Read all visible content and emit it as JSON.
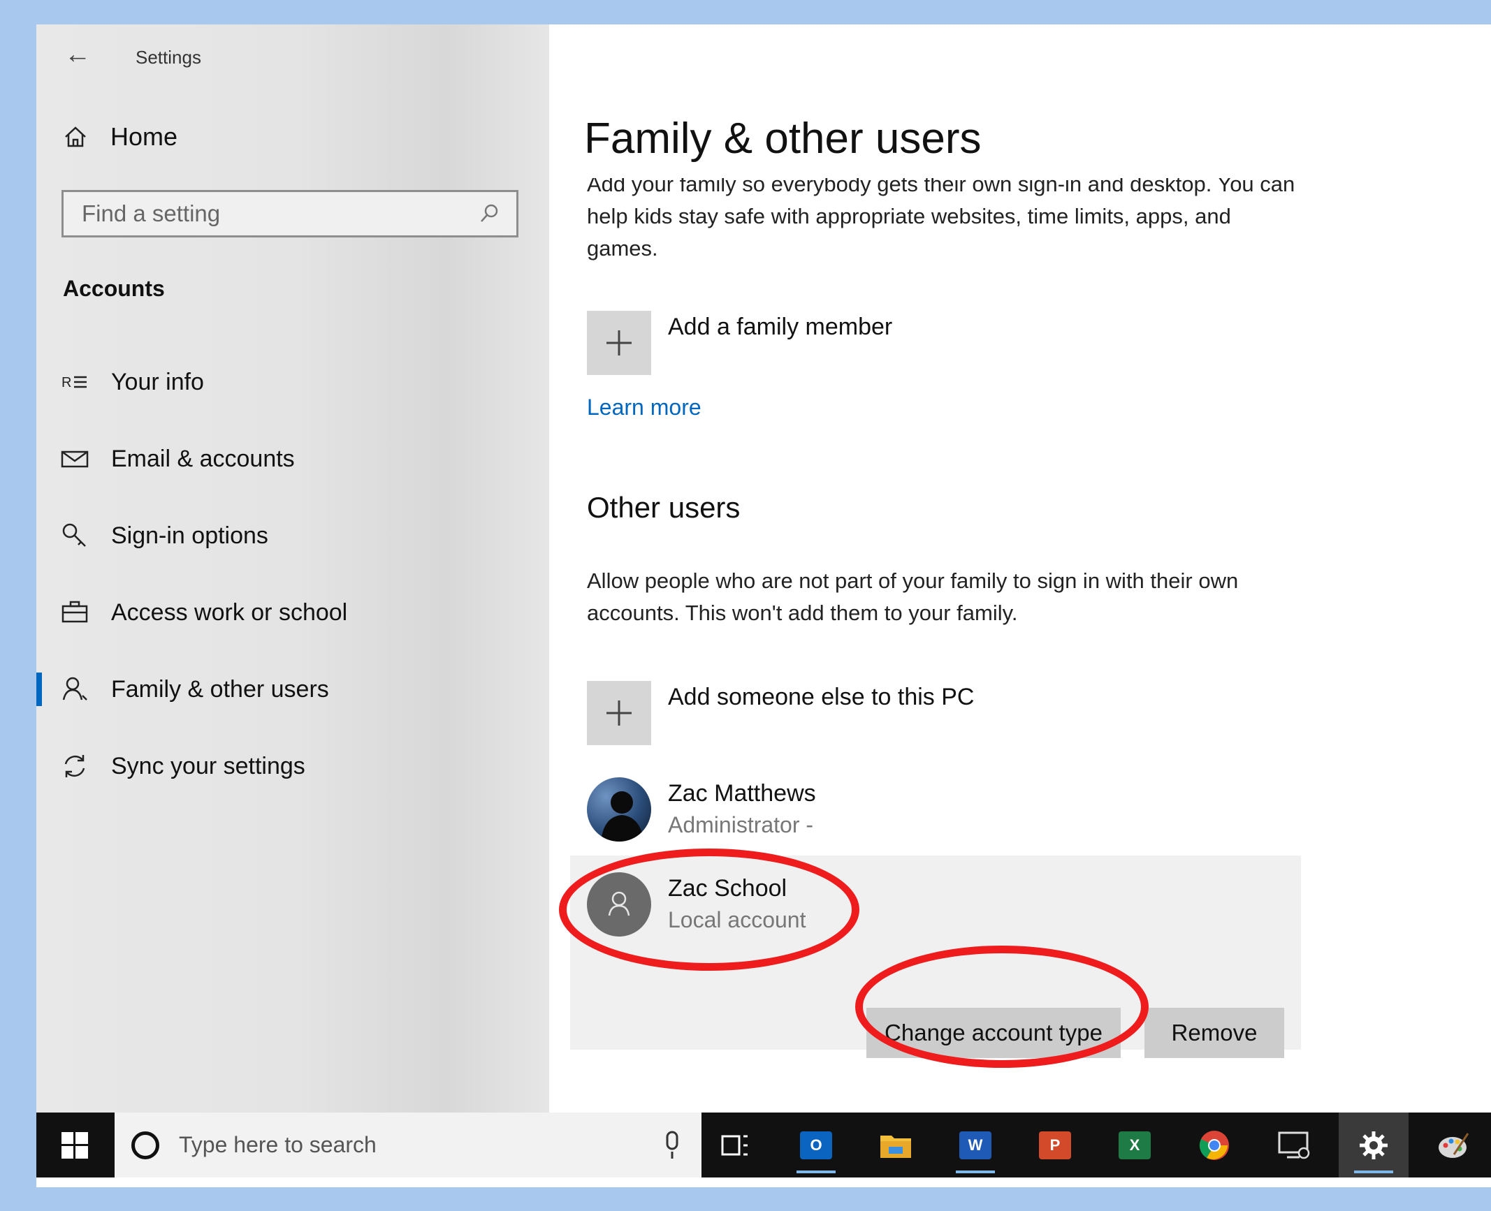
{
  "window": {
    "title": "Settings"
  },
  "sidebar": {
    "home_label": "Home",
    "search_placeholder": "Find a setting",
    "section_title": "Accounts",
    "items": [
      {
        "label": "Your info",
        "icon": "contact-card-icon"
      },
      {
        "label": "Email & accounts",
        "icon": "mail-icon"
      },
      {
        "label": "Sign-in options",
        "icon": "key-icon"
      },
      {
        "label": "Access work or school",
        "icon": "briefcase-icon"
      },
      {
        "label": "Family & other users",
        "icon": "person-icon",
        "active": true
      },
      {
        "label": "Sync your settings",
        "icon": "sync-icon"
      }
    ]
  },
  "main": {
    "title": "Family & other users",
    "family_description": "Add your family so everybody gets their own sign-in and desktop. You can help kids stay safe with appropriate websites, time limits, apps, and games.",
    "add_family_label": "Add a family member",
    "learn_more": "Learn more",
    "other_users_heading": "Other users",
    "other_users_description": "Allow people who are not part of your family to sign in with their own accounts. This won't add them to your family.",
    "add_someone_label": "Add someone else to this PC",
    "users": [
      {
        "name": "Zac Matthews",
        "subtitle": "Administrator -"
      },
      {
        "name": "Zac School",
        "subtitle": "Local account"
      }
    ],
    "change_account_type": "Change account type",
    "remove": "Remove"
  },
  "taskbar": {
    "search_placeholder": "Type here to search",
    "apps": [
      "task-view",
      "outlook",
      "file-explorer",
      "word",
      "powerpoint",
      "excel",
      "chrome",
      "remote-desktop",
      "settings",
      "paint"
    ]
  },
  "colors": {
    "accent": "#0067c0",
    "annotation": "#ee1c1c",
    "taskbar": "#111111"
  }
}
